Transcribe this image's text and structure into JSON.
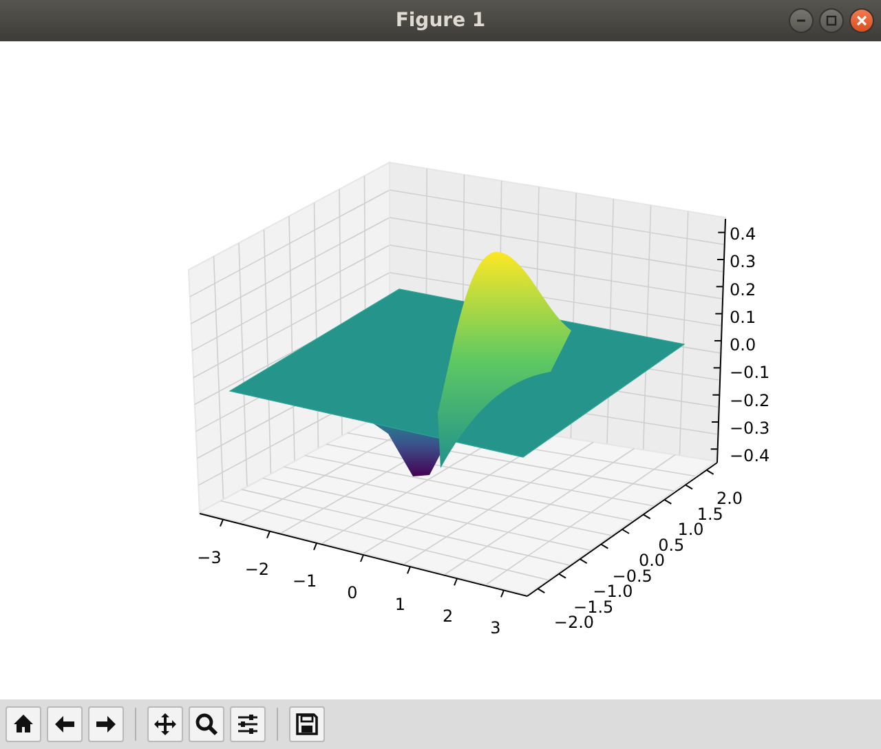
{
  "window": {
    "title": "Figure 1",
    "controls": [
      {
        "kind": "minimize"
      },
      {
        "kind": "maximize"
      },
      {
        "kind": "close"
      }
    ]
  },
  "plot": {
    "x_ticks": [
      "−3",
      "−2",
      "−1",
      "0",
      "1",
      "2",
      "3"
    ],
    "y_ticks": [
      "−2.0",
      "−1.5",
      "−1.0",
      "−0.5",
      "0.0",
      "0.5",
      "1.0",
      "1.5",
      "2.0"
    ],
    "z_ticks": [
      "0.4",
      "0.3",
      "0.2",
      "0.1",
      "0.0",
      "−0.1",
      "−0.2",
      "−0.3",
      "−0.4"
    ]
  },
  "toolbar": [
    [
      {
        "kind": "home"
      },
      {
        "kind": "back"
      },
      {
        "kind": "forward"
      }
    ],
    [
      {
        "kind": "pan"
      },
      {
        "kind": "zoom"
      },
      {
        "kind": "configure"
      }
    ],
    [
      {
        "kind": "save"
      }
    ]
  ]
}
